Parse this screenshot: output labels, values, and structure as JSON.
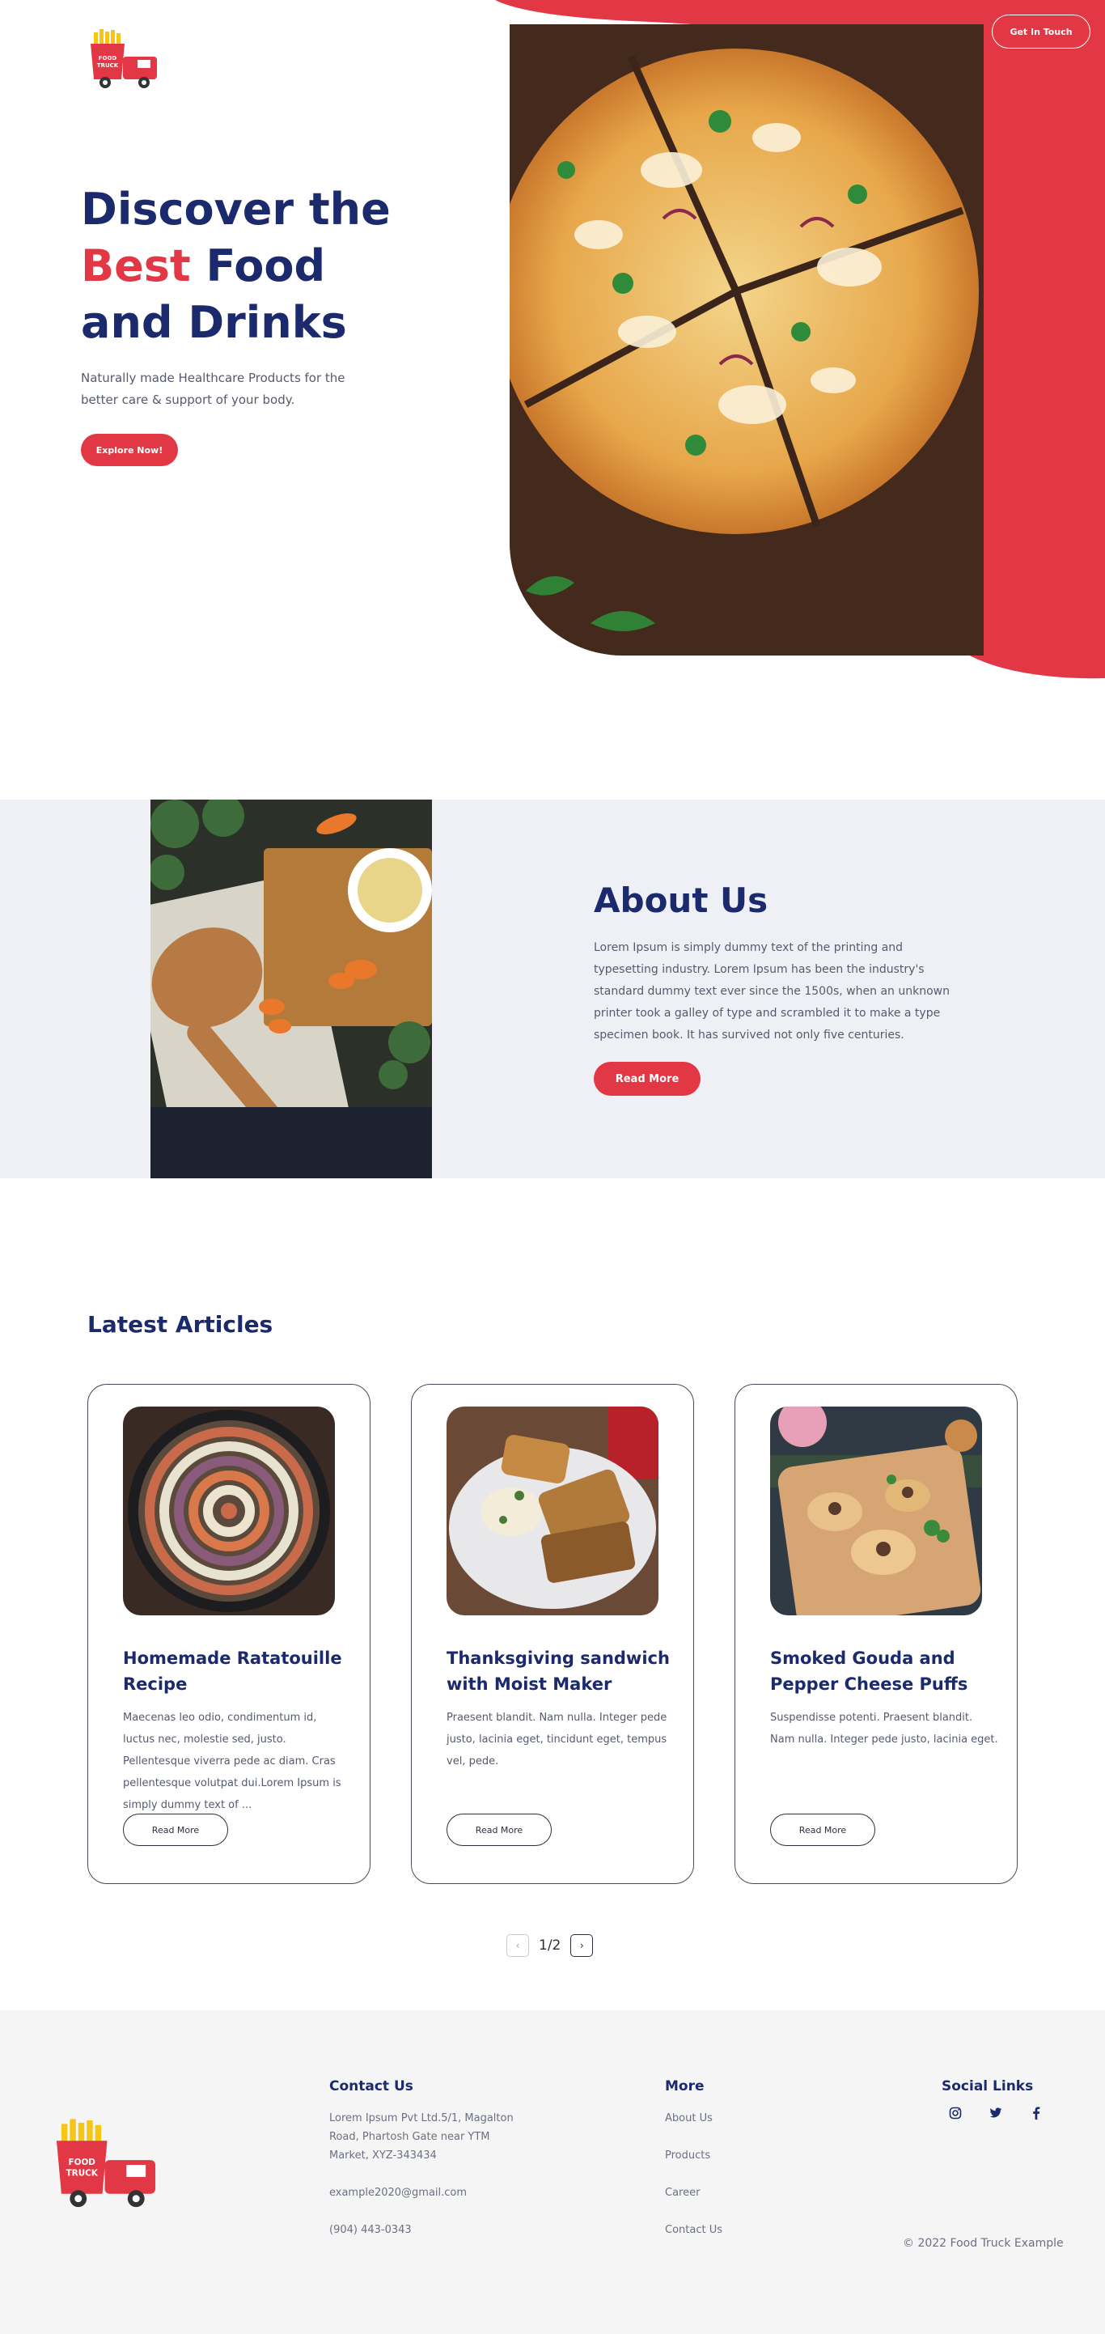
{
  "colors": {
    "primary": "#1a2a6c",
    "accent": "#e23744",
    "text_muted": "#555a6e",
    "about_bg": "#eff0f5",
    "footer_bg": "#f5f5f6"
  },
  "logo": {
    "line1": "FOOD",
    "line2": "TRUCK",
    "icon": "food-truck-logo"
  },
  "header": {
    "cta_label": "Get In Touch"
  },
  "hero": {
    "title_line1": "Discover the",
    "title_accent": "Best",
    "title_line2_rest": " Food",
    "title_line3": "and Drinks",
    "subtitle": "Naturally made Healthcare Products for the better care & support of your body.",
    "cta_label": "Explore Now!",
    "image": "pizza-photo"
  },
  "about": {
    "title": "About Us",
    "text": "Lorem Ipsum is simply dummy text of the printing and typesetting industry. Lorem Ipsum has been the industry's standard dummy text ever since the 1500s, when an unknown printer took a galley of type and scrambled it to make a type specimen book. It has survived not only five centuries.",
    "cta_label": "Read More",
    "image": "spices-spoon-photo"
  },
  "articles": {
    "title": "Latest Articles",
    "items": [
      {
        "title": "Homemade Ratatouille Recipe",
        "text": "Maecenas leo odio, condimentum id, luctus nec, molestie sed, justo. Pellentesque viverra pede ac diam. Cras pellentesque volutpat dui.Lorem Ipsum is simply dummy text of ...",
        "cta_label": "Read More",
        "image": "ratatouille-photo"
      },
      {
        "title": "Thanksgiving sandwich with Moist Maker",
        "text": "Praesent blandit. Nam nulla. Integer pede justo, lacinia eget, tincidunt eget, tempus vel, pede.",
        "cta_label": "Read More",
        "image": "sandwich-photo"
      },
      {
        "title": "Smoked Gouda and Pepper Cheese Puffs",
        "text": "Suspendisse potenti. Praesent blandit. Nam nulla. Integer pede justo, lacinia eget.",
        "cta_label": "Read More",
        "image": "cheese-puffs-photo"
      }
    ],
    "pagination": {
      "prev": "‹",
      "current": "1/2",
      "next": "›"
    }
  },
  "footer": {
    "contact": {
      "heading": "Contact Us",
      "address": "Lorem Ipsum Pvt Ltd.5/1, Magalton Road, Phartosh Gate near YTM Market, XYZ-343434",
      "email": "example2020@gmail.com",
      "phone": "(904) 443-0343"
    },
    "more": {
      "heading": "More",
      "links": [
        "About Us",
        "Products",
        "Career",
        "Contact Us"
      ]
    },
    "social": {
      "heading": "Social Links",
      "icons": [
        "instagram-icon",
        "twitter-icon",
        "facebook-icon"
      ]
    },
    "copyright": "© 2022 Food Truck Example"
  }
}
